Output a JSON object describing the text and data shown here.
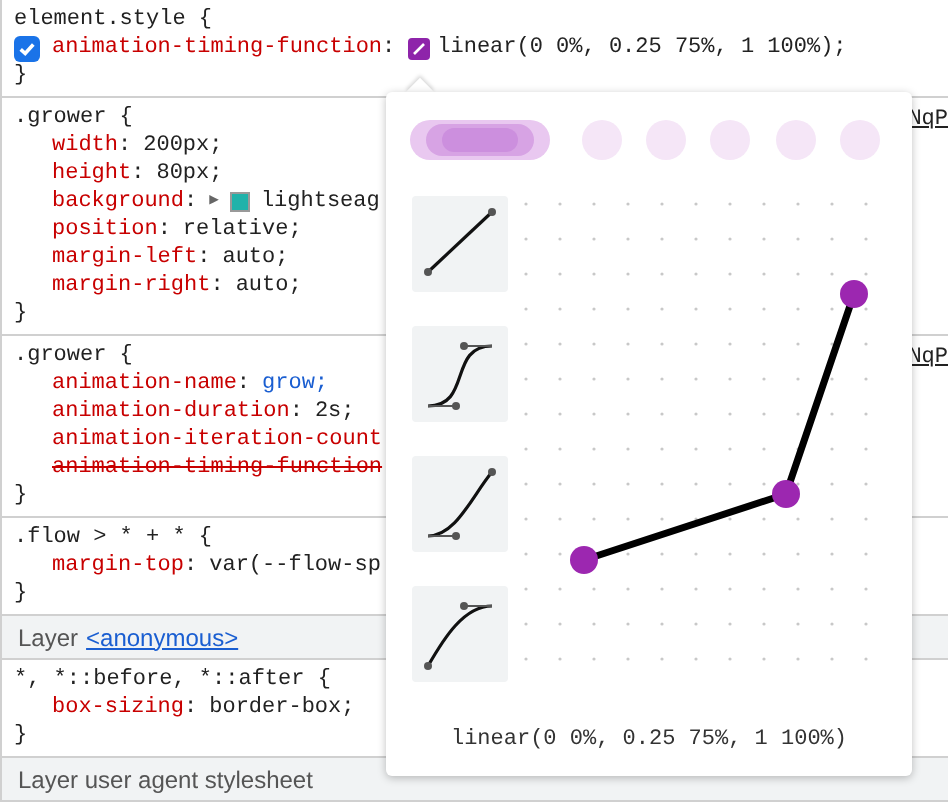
{
  "sections": [
    {
      "kind": "rule",
      "selector": "element.style {",
      "close": "}",
      "declarations": [
        {
          "kind": "easing",
          "property": "animation-timing-function",
          "colon": ":",
          "value": "linear(0 0%, 0.25 75%, 1 100%);",
          "checked": true,
          "overridden": false
        }
      ]
    },
    {
      "kind": "rule",
      "selector": ".grower {",
      "close": "}",
      "source": "NqP",
      "declarations": [
        {
          "kind": "plain",
          "property": "width",
          "colon": ":",
          "value": "200px;",
          "overridden": false
        },
        {
          "kind": "plain",
          "property": "height",
          "colon": ":",
          "value": "80px;",
          "overridden": false
        },
        {
          "kind": "color",
          "property": "background",
          "colon": ":",
          "expander": "▶",
          "value": "lightseag",
          "overridden": false
        },
        {
          "kind": "plain",
          "property": "position",
          "colon": ":",
          "value": "relative;",
          "overridden": false
        },
        {
          "kind": "plain",
          "property": "margin-left",
          "colon": ":",
          "value": "auto;",
          "overridden": false
        },
        {
          "kind": "plain",
          "property": "margin-right",
          "colon": ":",
          "value": "auto;",
          "overridden": false
        }
      ]
    },
    {
      "kind": "rule",
      "selector": ".grower {",
      "close": "}",
      "source": "NqP",
      "declarations": [
        {
          "kind": "keyword",
          "property": "animation-name",
          "colon": ":",
          "value": "grow;",
          "overridden": false
        },
        {
          "kind": "plain",
          "property": "animation-duration",
          "colon": ":",
          "value": "2s;",
          "overridden": false
        },
        {
          "kind": "plain",
          "property": "animation-iteration-count",
          "overridden": false
        },
        {
          "kind": "plain",
          "property": "animation-timing-function",
          "overridden": true
        }
      ]
    },
    {
      "kind": "rule",
      "selector": ".flow > * + * {",
      "close": "}",
      "declarations": [
        {
          "kind": "plain",
          "property": "margin-top",
          "colon": ":",
          "value": "var(--flow-sp",
          "overridden": false
        }
      ]
    },
    {
      "kind": "layer",
      "label": "Layer",
      "link": "<anonymous>"
    },
    {
      "kind": "rule",
      "selector": "*, *::before, *::after {",
      "close": "}",
      "declarations": [
        {
          "kind": "plain",
          "property": "box-sizing",
          "colon": ":",
          "value": "border-box;",
          "overridden": false
        }
      ]
    },
    {
      "kind": "layer",
      "label": "Layer user agent stylesheet"
    }
  ],
  "easing_editor": {
    "result": "linear(0 0%, 0.25 75%, 1 100%)"
  }
}
